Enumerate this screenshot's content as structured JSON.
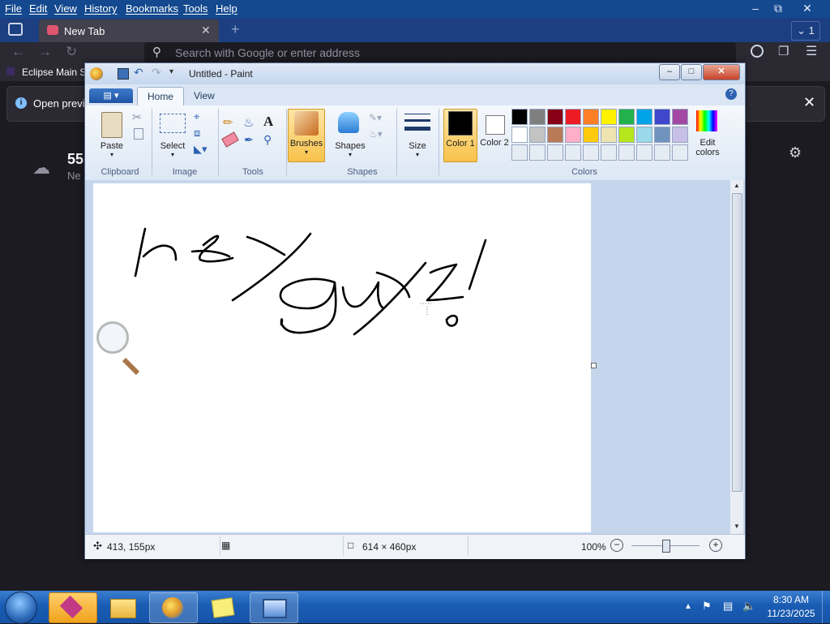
{
  "firefox": {
    "menu": [
      "File",
      "Edit",
      "View",
      "History",
      "Bookmarks",
      "Tools",
      "Help"
    ],
    "tab_label": "New Tab",
    "tab_counter": "1",
    "url_placeholder": "Search with Google or enter address",
    "bookmark_label": "Eclipse Main S",
    "notice_text": "Open previ",
    "weather_temp": "55",
    "weather_sub": "Ne"
  },
  "paint": {
    "title": "Untitled - Paint",
    "tabs": [
      "Home",
      "View"
    ],
    "groups": {
      "clipboard": "Clipboard",
      "image": "Image",
      "tools": "Tools",
      "shapes": "Shapes",
      "colors": "Colors"
    },
    "buttons": {
      "paste": "Paste",
      "select": "Select",
      "brushes": "Brushes",
      "shapes": "Shapes",
      "size": "Size",
      "color1": "Color 1",
      "color2": "Color 2",
      "edit_colors": "Edit colors"
    },
    "palette_row1": [
      "#000000",
      "#7f7f7f",
      "#880015",
      "#ed1c24",
      "#ff7f27",
      "#fff200",
      "#22b14c",
      "#00a2e8",
      "#3f48cc",
      "#a349a4"
    ],
    "palette_row2": [
      "#ffffff",
      "#c3c3c3",
      "#b97a57",
      "#ffaec9",
      "#ffc90e",
      "#efe4b0",
      "#b5e61d",
      "#99d9ea",
      "#7092be",
      "#c8bfe7"
    ],
    "color1_value": "#000000",
    "color2_value": "#ffffff",
    "canvas_text": "hey guyz!",
    "status": {
      "cursor_pos": "413, 155px",
      "canvas_size": "614 × 460px",
      "zoom": "100%"
    }
  },
  "taskbar": {
    "time": "8:30 AM",
    "date": "11/23/2025"
  }
}
